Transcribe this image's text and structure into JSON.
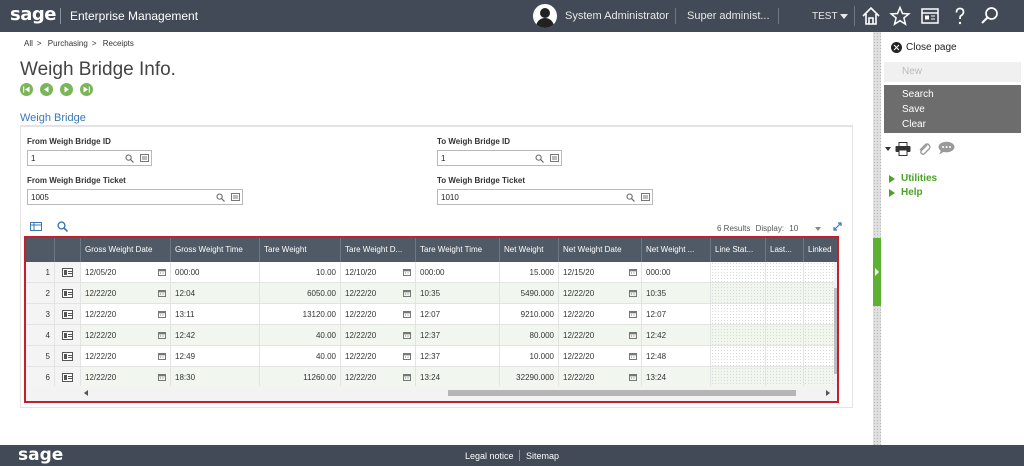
{
  "header": {
    "logo": "sage",
    "app_name": "Enterprise Management",
    "user": "System Administrator",
    "role": "Super administ...",
    "folder": "TEST"
  },
  "breadcrumb": [
    "All",
    "Purchasing",
    "Receipts"
  ],
  "page_title": "Weigh Bridge Info.",
  "section_title": "Weigh Bridge",
  "filters": {
    "from_id_label": "From Weigh Bridge ID",
    "from_id_value": "1",
    "to_id_label": "To Weigh Bridge ID",
    "to_id_value": "1",
    "from_ticket_label": "From Weigh Bridge Ticket",
    "from_ticket_value": "1005",
    "to_ticket_label": "To Weigh Bridge Ticket",
    "to_ticket_value": "1010"
  },
  "results": {
    "text": "6 Results",
    "display_label": "Display:",
    "display_value": "10"
  },
  "grid": {
    "columns": [
      "Gross Weight Date",
      "Gross Weight Time",
      "Tare Weight",
      "Tare Weight D...",
      "Tare Weight Time",
      "Net Weight",
      "Net Weight Date",
      "Net Weight ...",
      "Line Stat...",
      "Last...",
      "Linked"
    ],
    "rows": [
      {
        "n": "1",
        "gross_date": "12/05/20",
        "gross_time": "000:00",
        "tare": "10.00",
        "tare_date": "12/10/20",
        "tare_time": "000:00",
        "net": "15.000",
        "net_date": "12/15/20",
        "net_time": "000:00"
      },
      {
        "n": "2",
        "gross_date": "12/22/20",
        "gross_time": "12:04",
        "tare": "6050.00",
        "tare_date": "12/22/20",
        "tare_time": "10:35",
        "net": "5490.000",
        "net_date": "12/22/20",
        "net_time": "10:35"
      },
      {
        "n": "3",
        "gross_date": "12/22/20",
        "gross_time": "13:11",
        "tare": "13120.00",
        "tare_date": "12/22/20",
        "tare_time": "12:07",
        "net": "9210.000",
        "net_date": "12/22/20",
        "net_time": "12:07"
      },
      {
        "n": "4",
        "gross_date": "12/22/20",
        "gross_time": "12:42",
        "tare": "40.00",
        "tare_date": "12/22/20",
        "tare_time": "12:37",
        "net": "80.000",
        "net_date": "12/22/20",
        "net_time": "12:42"
      },
      {
        "n": "5",
        "gross_date": "12/22/20",
        "gross_time": "12:49",
        "tare": "40.00",
        "tare_date": "12/22/20",
        "tare_time": "12:37",
        "net": "10.000",
        "net_date": "12/22/20",
        "net_time": "12:48"
      },
      {
        "n": "6",
        "gross_date": "12/22/20",
        "gross_time": "18:30",
        "tare": "11260.00",
        "tare_date": "12/22/20",
        "tare_time": "13:24",
        "net": "32290.000",
        "net_date": "12/22/20",
        "net_time": "13:24"
      }
    ]
  },
  "right_panel": {
    "close_label": "Close page",
    "new_label": "New",
    "actions": [
      "Search",
      "Save",
      "Clear"
    ],
    "links": [
      "Utilities",
      "Help"
    ]
  },
  "footer": {
    "logo": "sage",
    "legal": "Legal notice",
    "sitemap": "Sitemap"
  },
  "colors": {
    "topbar": "#414a56",
    "accent_green": "#5cb032",
    "link_blue": "#3a78b5",
    "highlight_red": "#c61f2c",
    "grid_header": "#505a66"
  },
  "icons": [
    "home-icon",
    "star-icon",
    "news-icon",
    "help-icon",
    "search-icon",
    "calendar-icon",
    "print-icon",
    "attach-icon",
    "comment-icon"
  ]
}
